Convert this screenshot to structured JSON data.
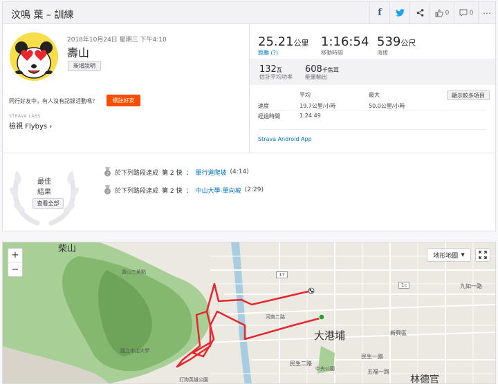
{
  "header": {
    "title": "汶鳴 葉 – 訓練",
    "kudos_count": "0",
    "comment_count": "0"
  },
  "activity": {
    "date": "2018年10月24日 星期三 下午4:10",
    "name": "壽山",
    "add_description": "新增說明",
    "invite_text": "同行好友中，有人沒有記錄活動嗎？",
    "invite_button": "標註好友",
    "labs_label": "STRAVA LABS",
    "flybys_label": "檢視 Flybys ›"
  },
  "stats": {
    "distance": {
      "value": "25.21",
      "unit": "公里",
      "label": "距離 (?)"
    },
    "moving_time": {
      "value": "1:16:54",
      "label": "移動時間"
    },
    "elevation": {
      "value": "539",
      "unit": "公尺",
      "label": "海拔"
    },
    "power": {
      "value": "132",
      "unit": "瓦",
      "label": "估計平均功率"
    },
    "energy": {
      "value": "608",
      "unit": "千焦耳",
      "label": "能量輸出"
    },
    "show_more": "顯示較多項目",
    "table": {
      "col_avg": "平均",
      "col_max": "最大",
      "speed_label": "速度",
      "speed_avg": "19.7公里/小時",
      "speed_max": "50.0公里/小時",
      "elapsed_label": "經過時間",
      "elapsed_avg": "1:24:49"
    },
    "device": "Strava Android App"
  },
  "achievements": {
    "best_title_1": "最佳",
    "best_title_2": "結果",
    "view_all": "查看全部",
    "rows": [
      {
        "prefix": "於下列路段達成",
        "rank": "第 2 快",
        "sep": "：",
        "segment": "單行道爬坡",
        "time": "(4:14)"
      },
      {
        "prefix": "於下列路段達成",
        "rank": "第 2 快",
        "sep": "：",
        "segment": "中山大學-單向坡",
        "time": "(2:29)"
      }
    ]
  },
  "map": {
    "zoom_in": "+",
    "zoom_out": "−",
    "map_type": "地形地圖",
    "labels": {
      "chaishan": "柴山",
      "shoushan": "壽山三角點",
      "dagangpu": "大港埔",
      "lindeguan": "林德官",
      "park": "打狗英雄公園",
      "nsysu": "國立中山大學",
      "henan2": "河南二路",
      "minsheng1": "民生一路",
      "minsheng2": "民生二路",
      "wufu": "五福一路",
      "jiuru": "九如一路",
      "zhongzheng": "中央公園",
      "xinxing": "新興區",
      "road17": "17",
      "road1c": "1c"
    }
  }
}
